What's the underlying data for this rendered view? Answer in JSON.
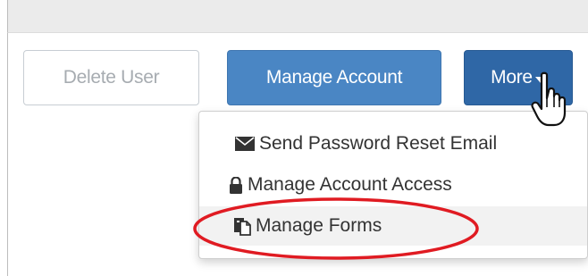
{
  "toolbar": {
    "delete_user_label": "Delete User",
    "manage_account_label": "Manage Account",
    "more_label": "More"
  },
  "dropdown": {
    "items": [
      {
        "label": "Send Password Reset Email",
        "icon": "envelope-icon"
      },
      {
        "label": "Manage Account Access",
        "icon": "lock-icon"
      },
      {
        "label": "Manage Forms",
        "icon": "forms-icon"
      }
    ]
  },
  "annotation": {
    "highlight_color": "#e01b22"
  },
  "colors": {
    "primary_button": "#4a86c4",
    "more_button": "#2f67a6",
    "disabled_text": "#a7acb1"
  }
}
